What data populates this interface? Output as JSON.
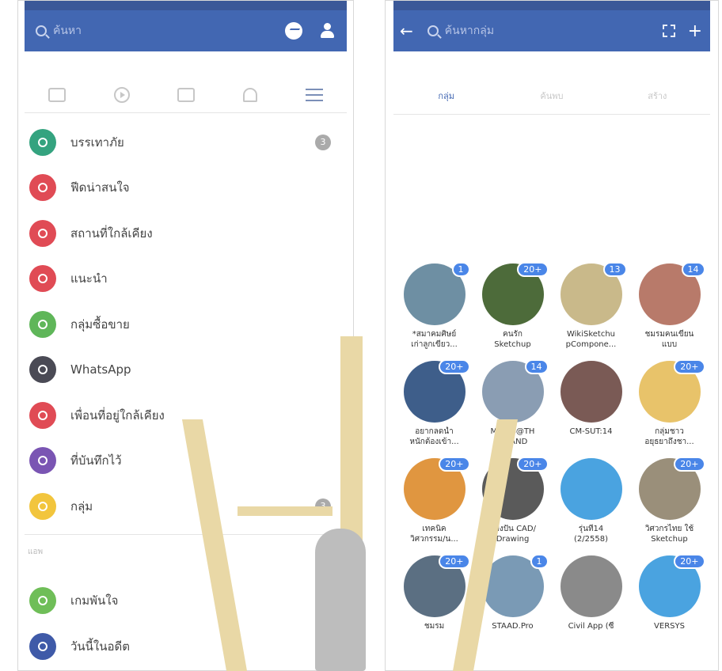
{
  "left": {
    "search_placeholder": "ค้นหา",
    "menu_items": [
      {
        "label": "บรรเทาภัย",
        "color": "#34a37f",
        "badge": "3"
      },
      {
        "label": "ฟีดน่าสนใจ",
        "color": "#e04b55",
        "badge": ""
      },
      {
        "label": "สถานที่ใกล้เคียง",
        "color": "#e04b55",
        "badge": ""
      },
      {
        "label": "แนะนำ",
        "color": "#e04b55",
        "badge": ""
      },
      {
        "label": "กลุ่มซื้อขาย",
        "color": "#5fb659",
        "badge": ""
      },
      {
        "label": "WhatsApp",
        "color": "#4a4a55",
        "badge": ""
      },
      {
        "label": "เพื่อนที่อยู่ใกล้เคียง",
        "color": "#e04b55",
        "badge": ""
      },
      {
        "label": "ที่บันทึกไว้",
        "color": "#7a55b3",
        "badge": ""
      },
      {
        "label": "กลุ่ม",
        "color": "#f2c53d",
        "badge": "3"
      }
    ],
    "section_label": "แอพ",
    "app_items": [
      {
        "label": "เกมพันใจ",
        "color": "#6fbe58",
        "badge": ""
      },
      {
        "label": "วันนี้ในอดีต",
        "color": "#3f5aa8",
        "badge": "4"
      }
    ]
  },
  "right": {
    "search_placeholder": "ค้นหากลุ่ม",
    "tabs": [
      "กลุ่ม",
      "ค้นพบ",
      "สร้าง"
    ],
    "groups": [
      {
        "name": "*สมาคมศิษย์\nเก่าลูกเขียว...",
        "badge": "1",
        "color": "#6e8fa3"
      },
      {
        "name": "คนรัก\nSketchup",
        "badge": "20+",
        "color": "#4d6b3a"
      },
      {
        "name": "WikiSketchu\npCompone...",
        "badge": "13",
        "color": "#c9b98a"
      },
      {
        "name": "ชมรมคนเขียน\nแบบ",
        "badge": "14",
        "color": "#b87a6a"
      },
      {
        "name": "อยากลดน้ำ\nหนักต้องเข้า...",
        "badge": "20+",
        "color": "#3e5e8a"
      },
      {
        "name": "MIDAS@TH\nAILAND",
        "badge": "14",
        "color": "#8a9db3"
      },
      {
        "name": "CM-SUT:14",
        "badge": "",
        "color": "#7a5a55"
      },
      {
        "name": "กลุ่มชาว\nอยุธยาถึงชา...",
        "badge": "20+",
        "color": "#e8c36a"
      },
      {
        "name": "เทคนิค\nวิศวกรรม/น...",
        "badge": "20+",
        "color": "#e09640"
      },
      {
        "name": "แบ่งปัน CAD/\nDrawing",
        "badge": "20+",
        "color": "#5a5a5a"
      },
      {
        "name": "รุ่นที่14\n(2/2558)",
        "badge": "",
        "color": "#4aa3e0"
      },
      {
        "name": "วิศวกรไทย ใช้\nSketchup",
        "badge": "20+",
        "color": "#9a8f7a"
      },
      {
        "name": "ชมรม",
        "badge": "20+",
        "color": "#5b6f82"
      },
      {
        "name": "STAAD.Pro",
        "badge": "1",
        "color": "#7a9ab5"
      },
      {
        "name": "Civil App (ซี",
        "badge": "",
        "color": "#8a8a8a"
      },
      {
        "name": "VERSYS",
        "badge": "20+",
        "color": "#4aa3e0"
      }
    ]
  }
}
